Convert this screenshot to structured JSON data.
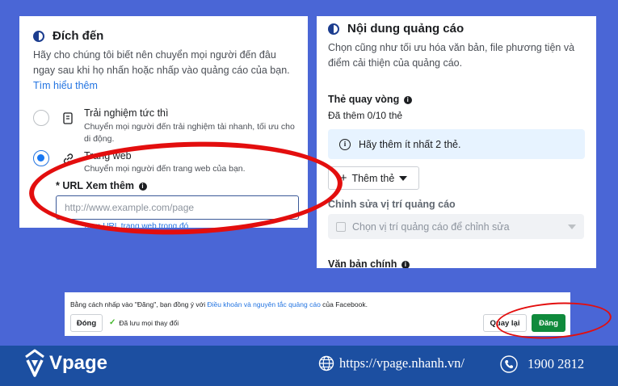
{
  "left_panel": {
    "title": "Đích đến",
    "description": "Hãy cho chúng tôi biết nên chuyển mọi người đến đâu ngay sau khi họ nhấn hoặc nhấp vào quảng cáo của bạn.",
    "learn_more": "Tìm hiểu thêm",
    "options": [
      {
        "title": "Trải nghiệm tức thì",
        "description": "Chuyển mọi người đến trải nghiệm tải nhanh, tối ưu cho di động.",
        "icon": "mobile-icon",
        "selected": false
      },
      {
        "title": "Trang web",
        "description": "Chuyển mọi người đến trang web của bạn.",
        "icon": "link-icon",
        "selected": true
      }
    ],
    "url_label": "* URL Xem thêm",
    "url_placeholder": "http://www.example.com/page",
    "url_value": "",
    "under_link": "Xem URL trang web trong đó"
  },
  "right_panel": {
    "title": "Nội dung quảng cáo",
    "description": "Chọn cũng như tối ưu hóa văn bản, file phương tiện và điểm cải thiện của quảng cáo.",
    "carousel_label": "Thẻ quay vòng",
    "carousel_count": "Đã thêm 0/10 thẻ",
    "info_message": "Hãy thêm ít nhất 2 thẻ.",
    "add_card_button": "Thêm thẻ",
    "placement_label": "Chỉnh sửa vị trí quảng cáo",
    "placement_placeholder": "Chọn vị trí quảng cáo để chỉnh sửa",
    "primary_text_label": "Văn bản chính"
  },
  "bottom_bar": {
    "terms_prefix": "Bằng cách nhấp vào \"Đăng\", bạn đồng ý với ",
    "terms_link": "Điều khoản và nguyên tắc quảng cáo",
    "terms_suffix": " của Facebook.",
    "close_button": "Đóng",
    "saved_status": "Đã lưu mọi thay đổi",
    "back_button": "Quay lại",
    "post_button": "Đăng"
  },
  "footer": {
    "brand": "Vpage",
    "website": "https://vpage.nhanh.vn/",
    "phone": "1900 2812"
  },
  "colors": {
    "background": "#4a66d6",
    "footer": "#1c4fa1",
    "accent": "#1877f2",
    "post_button": "#0f8a3c",
    "annotation": "#e30e0e"
  }
}
